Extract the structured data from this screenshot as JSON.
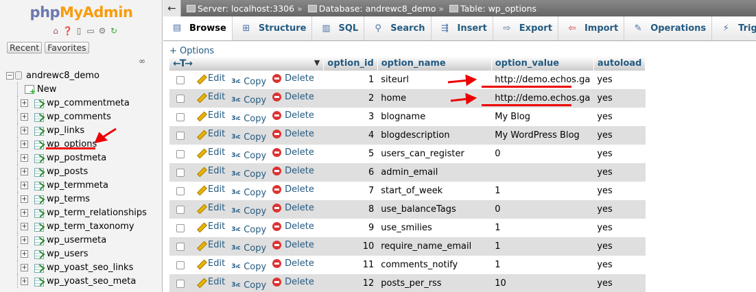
{
  "nav": {
    "logo_php": "php",
    "logo_my": "My",
    "logo_admin": "Admin",
    "icons": [
      "home-icon",
      "help-icon",
      "docs-icon",
      "copy-icon",
      "settings-icon",
      "reload-icon"
    ],
    "recent_label": "Recent",
    "favorites_label": "Favorites",
    "database": "andrewc8_demo",
    "new_label": "New",
    "tables": [
      "wp_commentmeta",
      "wp_comments",
      "wp_links",
      "wp_options",
      "wp_postmeta",
      "wp_posts",
      "wp_termmeta",
      "wp_terms",
      "wp_term_relationships",
      "wp_term_taxonomy",
      "wp_usermeta",
      "wp_users",
      "wp_yoast_seo_links",
      "wp_yoast_seo_meta"
    ],
    "selected_table": "wp_options"
  },
  "breadcrumb": {
    "server": "Server: localhost:3306",
    "database": "Database: andrewc8_demo",
    "table": "Table: wp_options",
    "separator": "»"
  },
  "tabs": [
    {
      "label": "Browse",
      "icon": "browse-icon",
      "active": true
    },
    {
      "label": "Structure",
      "icon": "structure-icon"
    },
    {
      "label": "SQL",
      "icon": "sql-icon"
    },
    {
      "label": "Search",
      "icon": "search-icon"
    },
    {
      "label": "Insert",
      "icon": "insert-icon"
    },
    {
      "label": "Export",
      "icon": "export-icon"
    },
    {
      "label": "Import",
      "icon": "import-icon"
    },
    {
      "label": "Operations",
      "icon": "operations-icon"
    },
    {
      "label": "Triggers",
      "icon": "triggers-icon"
    }
  ],
  "grid": {
    "options_link": "+ Options",
    "columns": [
      "option_id",
      "option_name",
      "option_value",
      "autoload"
    ],
    "actions": {
      "edit": "Edit",
      "copy": "Copy",
      "delete": "Delete"
    },
    "rows": [
      {
        "option_id": "1",
        "option_name": "siteurl",
        "option_value": "http://demo.echos.ga",
        "autoload": "yes"
      },
      {
        "option_id": "2",
        "option_name": "home",
        "option_value": "http://demo.echos.ga",
        "autoload": "yes"
      },
      {
        "option_id": "3",
        "option_name": "blogname",
        "option_value": "My Blog",
        "autoload": "yes"
      },
      {
        "option_id": "4",
        "option_name": "blogdescription",
        "option_value": "My WordPress Blog",
        "autoload": "yes"
      },
      {
        "option_id": "5",
        "option_name": "users_can_register",
        "option_value": "0",
        "autoload": "yes"
      },
      {
        "option_id": "6",
        "option_name": "admin_email",
        "option_value": "",
        "autoload": "yes"
      },
      {
        "option_id": "7",
        "option_name": "start_of_week",
        "option_value": "1",
        "autoload": "yes"
      },
      {
        "option_id": "8",
        "option_name": "use_balanceTags",
        "option_value": "0",
        "autoload": "yes"
      },
      {
        "option_id": "9",
        "option_name": "use_smilies",
        "option_value": "1",
        "autoload": "yes"
      },
      {
        "option_id": "10",
        "option_name": "require_name_email",
        "option_value": "1",
        "autoload": "yes"
      },
      {
        "option_id": "11",
        "option_name": "comments_notify",
        "option_value": "1",
        "autoload": "yes"
      },
      {
        "option_id": "12",
        "option_name": "posts_per_rss",
        "option_value": "10",
        "autoload": "yes"
      }
    ]
  },
  "colors": {
    "link": "#235a81",
    "annotation": "#ee0000",
    "logo_blue": "#6c78af",
    "logo_orange": "#f89c0e"
  }
}
